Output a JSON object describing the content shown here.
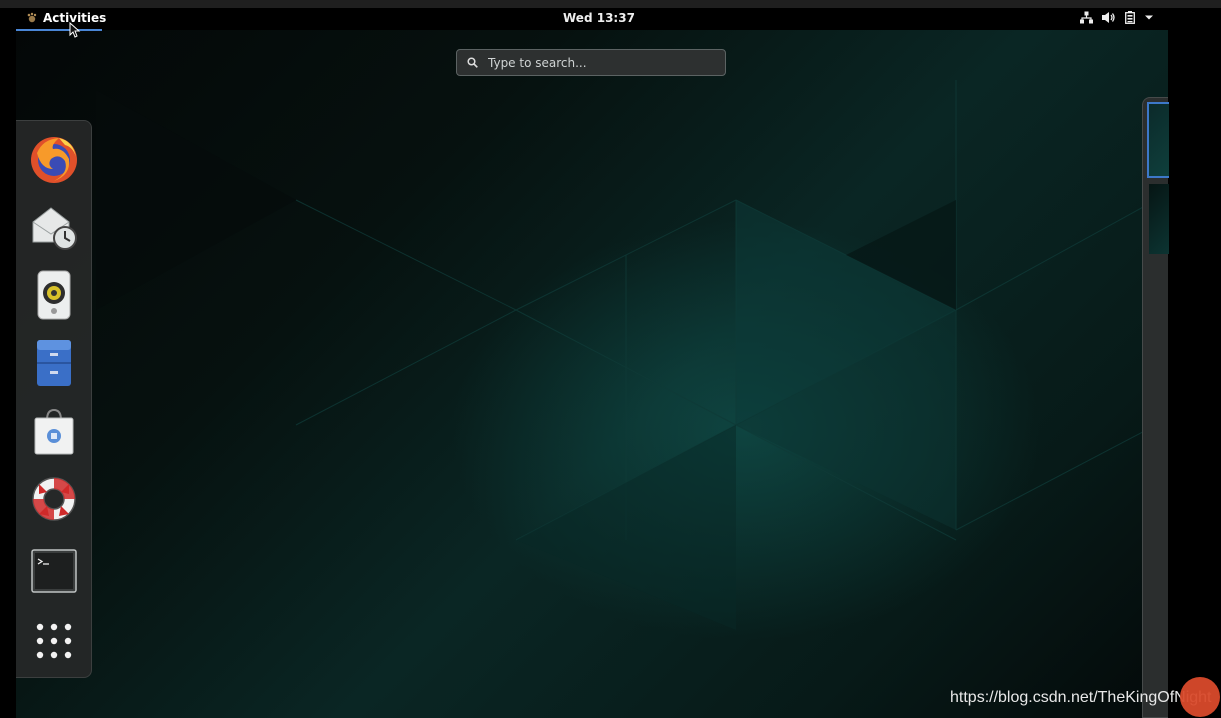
{
  "topbar": {
    "activities_label": "Activities",
    "clock": "Wed 13:37",
    "tray_icons": [
      "network-icon",
      "volume-icon",
      "battery-icon",
      "system-menu-arrow-icon"
    ]
  },
  "search": {
    "placeholder": "Type to search..."
  },
  "dash": {
    "items": [
      {
        "name": "Firefox",
        "icon": "firefox-icon"
      },
      {
        "name": "Evolution",
        "icon": "mail-clock-icon"
      },
      {
        "name": "Rhythmbox",
        "icon": "speaker-icon"
      },
      {
        "name": "Files",
        "icon": "file-cabinet-icon"
      },
      {
        "name": "Software",
        "icon": "shopping-bag-icon"
      },
      {
        "name": "Help",
        "icon": "lifebuoy-icon"
      },
      {
        "name": "Terminal",
        "icon": "terminal-icon"
      },
      {
        "name": "Show Applications",
        "icon": "app-grid-icon"
      }
    ]
  },
  "watermark": "https://blog.csdn.net/TheKingOfNight",
  "colors": {
    "accent": "#4a86d6",
    "panel": "#000000",
    "dash_bg": "#262828"
  }
}
